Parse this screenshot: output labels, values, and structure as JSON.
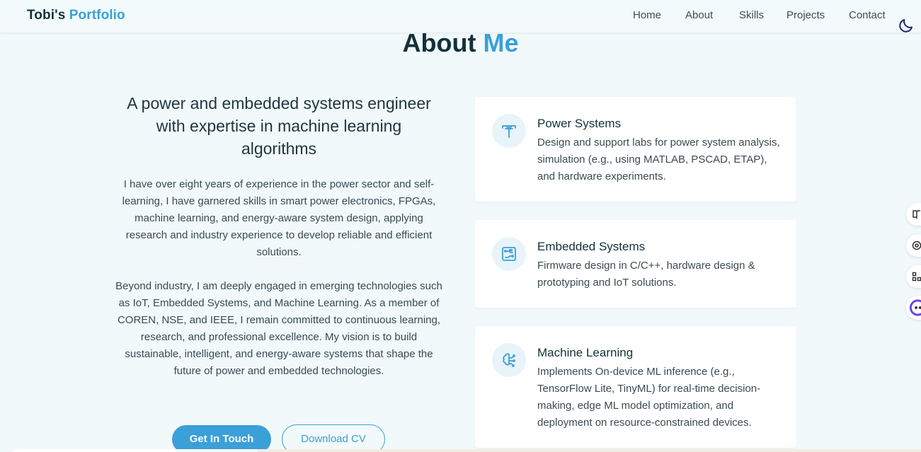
{
  "navbar": {
    "brand_part1": "Tobi's",
    "brand_part2": "Portfolio",
    "links": [
      "Home",
      "About",
      "Skills",
      "Projects",
      "Contact"
    ],
    "theme_toggle_icon": "moon-icon"
  },
  "about": {
    "title_part1": "About",
    "title_part2": "Me",
    "tagline": "A power and embedded systems engineer with expertise in machine learning algorithms",
    "paragraph1": "I have over eight years of experience in the power sector and self-learning, I have garnered skills in smart power electronics, FPGAs, machine learning, and energy-aware system design, applying research and industry experience to develop reliable and efficient solutions.",
    "paragraph2": "Beyond industry, I am deeply engaged in emerging technologies such as IoT, Embedded Systems, and Machine Learning. As a member of COREN, NSE, and IEEE, I remain committed to continuous learning, research, and professional excellence. My vision is to build sustainable, intelligent, and energy-aware systems that shape the future of power and embedded technologies.",
    "primary_button": "Get In Touch",
    "secondary_button": "Download CV"
  },
  "cards": [
    {
      "icon": "power-tower-icon",
      "title": "Power Systems",
      "description": "Design and support labs for power system analysis, simulation (e.g., using MATLAB, PSCAD, ETAP), and hardware experiments."
    },
    {
      "icon": "circuit-board-icon",
      "title": "Embedded Systems",
      "description": "Firmware design in C/C++, hardware design & prototyping and IoT solutions."
    },
    {
      "icon": "brain-circuit-icon",
      "title": "Machine Learning",
      "description": "Implements On-device ML inference (e.g., TensorFlow Lite, TinyML) for real-time decision-making, edge ML model optimization, and deployment on resource-constrained devices."
    }
  ],
  "floating_tools": [
    "book-icon",
    "at-sign-icon",
    "grid-icon",
    "assistant-icon"
  ],
  "colors": {
    "accent": "#3aa0d8",
    "heading": "#12313a",
    "background": "#f1f9fb",
    "card": "#ffffff"
  }
}
